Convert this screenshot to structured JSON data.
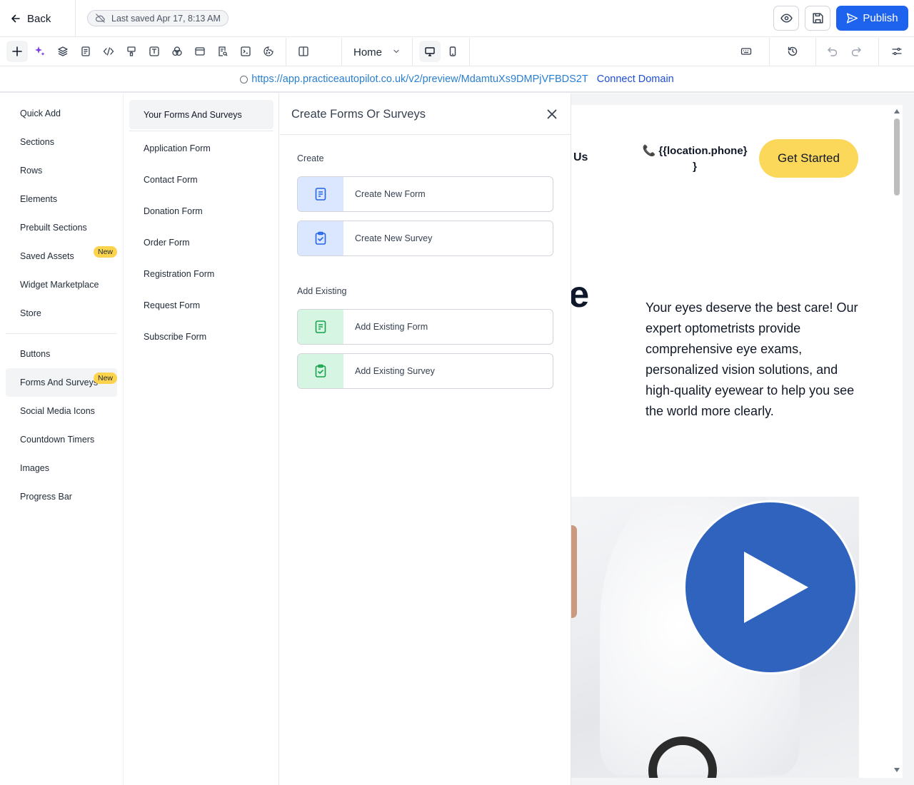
{
  "header": {
    "back_label": "Back",
    "saved_text": "Last saved Apr 17, 8:13 AM",
    "publish_label": "Publish"
  },
  "toolbar": {
    "page_select": "Home",
    "icons": [
      "add-icon",
      "ai-sparkle-icon",
      "layers-icon",
      "page-icon",
      "code-icon",
      "paint-bucket-icon",
      "text-style-icon",
      "color-blend-icon",
      "browser-window-icon",
      "search-document-icon",
      "terminal-icon",
      "cookie-icon",
      "columns-icon",
      "desktop-icon",
      "mobile-icon",
      "keyboard-icon",
      "history-icon",
      "undo-icon",
      "redo-icon",
      "settings-sliders-icon"
    ]
  },
  "urlbar": {
    "url": "https://app.practiceautopilot.co.uk/v2/preview/MdamtuXs9DMPjVFBDS2T",
    "connect_label": "Connect Domain"
  },
  "categories": [
    {
      "label": "Quick Add"
    },
    {
      "label": "Sections"
    },
    {
      "label": "Rows"
    },
    {
      "label": "Elements"
    },
    {
      "label": "Prebuilt Sections"
    },
    {
      "label": "Saved Assets",
      "badge": "New"
    },
    {
      "label": "Widget Marketplace"
    },
    {
      "label": "Store"
    },
    {
      "label": "Buttons"
    },
    {
      "label": "Forms And Surveys",
      "badge": "New",
      "active": true
    },
    {
      "label": "Social Media Icons"
    },
    {
      "label": "Countdown Timers"
    },
    {
      "label": "Images"
    },
    {
      "label": "Progress Bar"
    }
  ],
  "subpanel": {
    "heading": "Your Forms And Surveys",
    "items": [
      "Application Form",
      "Contact Form",
      "Donation Form",
      "Order Form",
      "Registration Form",
      "Request Form",
      "Subscribe Form"
    ]
  },
  "create_panel": {
    "title": "Create Forms Or Surveys",
    "create_heading": "Create",
    "create_items": [
      "Create New Form",
      "Create New Survey"
    ],
    "existing_heading": "Add Existing",
    "existing_items": [
      "Add Existing Form",
      "Add Existing Survey"
    ]
  },
  "preview": {
    "nav_fragment": "Us",
    "phone_text": "{{location.phone}\n}",
    "cta_label": "Get Started",
    "hero_fragment": "re",
    "hero_text": "Your eyes deserve the best care! Our expert optometrists provide comprehensive eye exams, personalized vision solutions, and high-quality eyewear to help you see the world more clearly."
  },
  "colors": {
    "primary": "#1d63ed",
    "badge": "#fbd34d",
    "cta": "#fbd85a",
    "play": "#2f63be",
    "create_icon_bg": "#dbe7ff",
    "existing_icon_bg": "#d7f5e3"
  }
}
